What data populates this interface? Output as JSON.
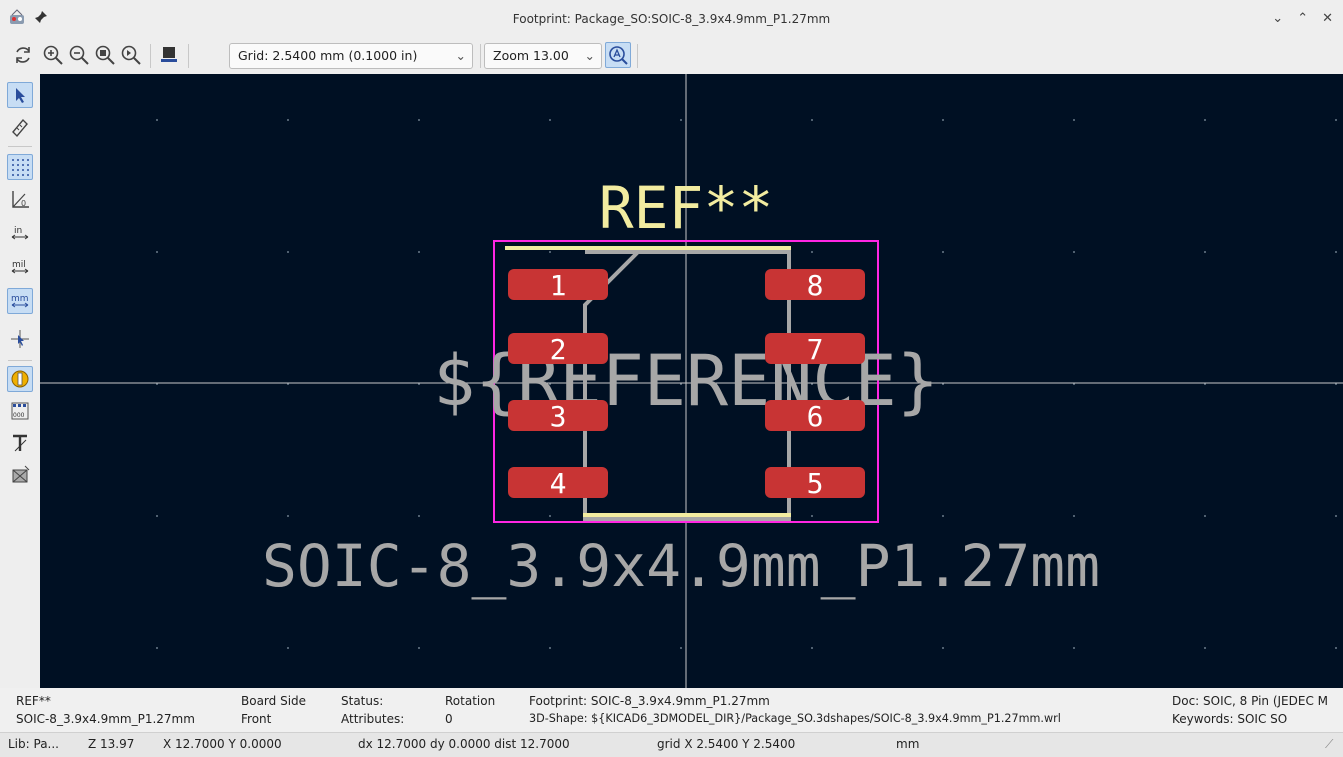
{
  "window": {
    "title": "Footprint: Package_SO:SOIC-8_3.9x4.9mm_P1.27mm",
    "controls": [
      "⌄",
      "⌃",
      "✕"
    ]
  },
  "toolbar": {
    "grid_label": "Grid: 2.5400 mm (0.1000 in)",
    "zoom_label": "Zoom 13.00"
  },
  "canvas": {
    "ref_text": "REF**",
    "ref_var_text": "${REFERENCE}",
    "value_text": "SOIC-8_3.9x4.9mm_P1.27mm",
    "pads": [
      "1",
      "2",
      "3",
      "4",
      "5",
      "6",
      "7",
      "8"
    ],
    "colors": {
      "background": "#001023",
      "pad": "#c83434",
      "silk": "#f2eca0",
      "fab": "#a7a7a7",
      "courtyard": "#ff26e2"
    }
  },
  "info": {
    "ref": "REF**",
    "name": "SOIC-8_3.9x4.9mm_P1.27mm",
    "board_side_label": "Board Side",
    "board_side_value": "Front",
    "status_label": "Status:",
    "attributes_label": "Attributes:",
    "rotation_label": "Rotation",
    "rotation_value": "0",
    "footprint": "Footprint: SOIC-8_3.9x4.9mm_P1.27mm",
    "shape3d": "3D-Shape: ${KICAD6_3DMODEL_DIR}/Package_SO.3dshapes/SOIC-8_3.9x4.9mm_P1.27mm.wrl",
    "doc": "Doc: SOIC, 8 Pin (JEDEC M",
    "keywords": "Keywords: SOIC SO"
  },
  "statusbar": {
    "lib": "Lib: Pa...",
    "z": "Z 13.97",
    "xy": "X 12.7000  Y 0.0000",
    "dxdy": "dx 12.7000  dy 0.0000  dist 12.7000",
    "grid": "grid X 2.5400  Y 2.5400",
    "units": "mm"
  }
}
